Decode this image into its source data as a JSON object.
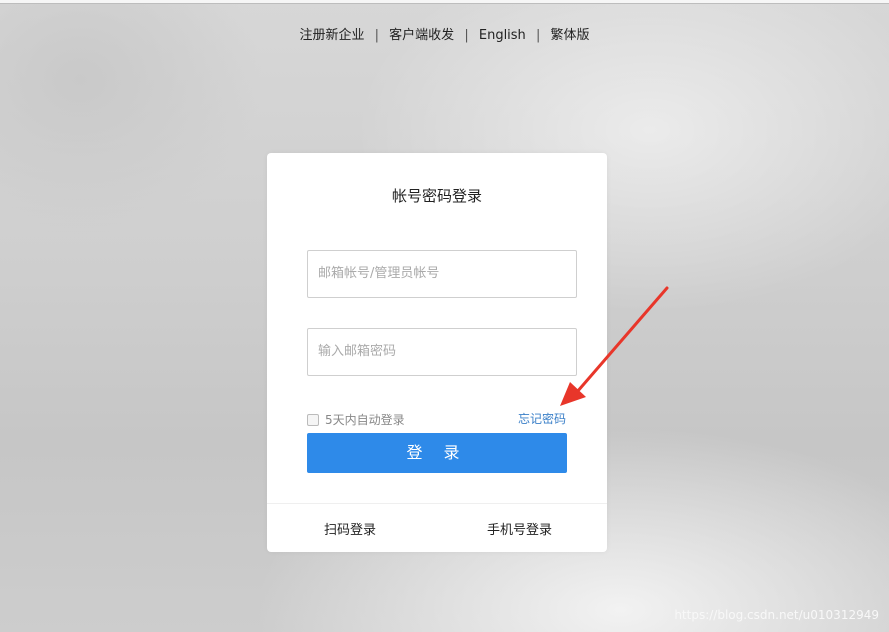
{
  "top_links": [
    "注册新企业",
    "客户端收发",
    "English",
    "繁体版"
  ],
  "top_separator": "|",
  "card": {
    "title": "帐号密码登录",
    "username_placeholder": "邮箱帐号/管理员帐号",
    "password_placeholder": "输入邮箱密码",
    "remember_label": "5天内自动登录",
    "forgot_label": "忘记密码",
    "login_button": "登 录",
    "qr_login": "扫码登录",
    "phone_login": "手机号登录"
  },
  "watermark": "https://blog.csdn.net/u010312949",
  "colors": {
    "primary": "#2e8ae9",
    "link": "#3a7fc8",
    "arrow": "#e8362a"
  }
}
